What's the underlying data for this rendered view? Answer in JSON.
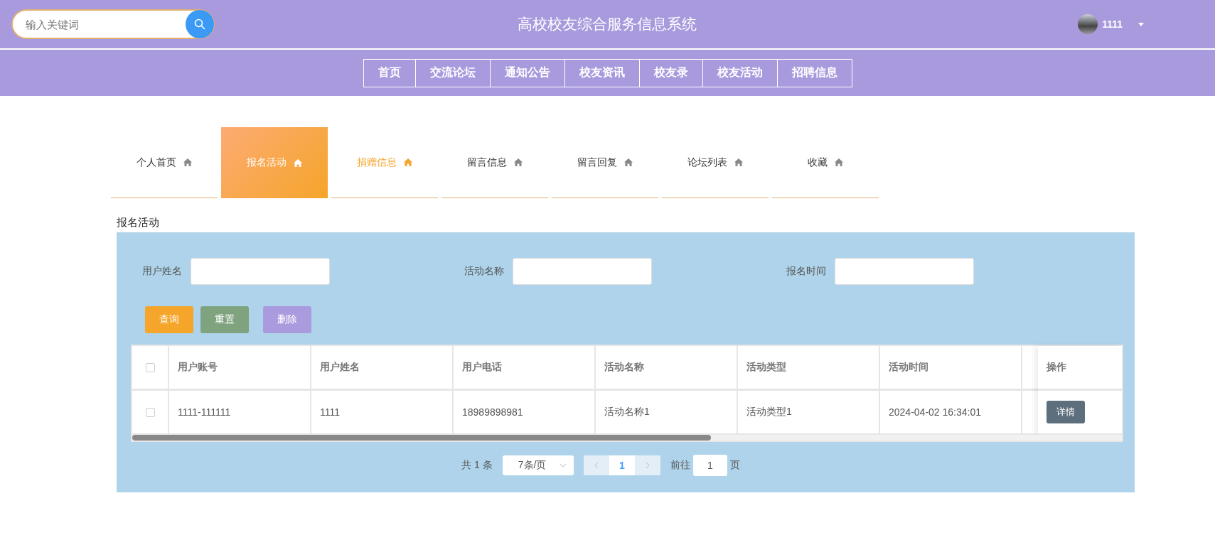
{
  "header": {
    "search": {
      "placeholder": "输入关键词"
    },
    "title": "高校校友综合服务信息系统",
    "user": {
      "name": "1111"
    }
  },
  "nav": [
    {
      "label": "首页"
    },
    {
      "label": "交流论坛"
    },
    {
      "label": "通知公告"
    },
    {
      "label": "校友资讯"
    },
    {
      "label": "校友录"
    },
    {
      "label": "校友活动"
    },
    {
      "label": "招聘信息"
    }
  ],
  "tabs": [
    {
      "label": "个人首页",
      "selected": false,
      "hovered": false
    },
    {
      "label": "报名活动",
      "selected": true,
      "hovered": false
    },
    {
      "label": "捐赠信息",
      "selected": false,
      "hovered": true
    },
    {
      "label": "留言信息",
      "selected": false,
      "hovered": false
    },
    {
      "label": "留言回复",
      "selected": false,
      "hovered": false
    },
    {
      "label": "论坛列表",
      "selected": false,
      "hovered": false
    },
    {
      "label": "收藏",
      "selected": false,
      "hovered": false
    }
  ],
  "section_title": "报名活动",
  "filters": [
    {
      "label": "用户姓名"
    },
    {
      "label": "活动名称"
    },
    {
      "label": "报名时间"
    }
  ],
  "buttons": [
    {
      "label": "查询",
      "kind": "query"
    },
    {
      "label": "重置",
      "kind": "reset"
    },
    {
      "label": "删除",
      "kind": "delete"
    }
  ],
  "table": {
    "columns": [
      "用户账号",
      "用户姓名",
      "用户电话",
      "活动名称",
      "活动类型",
      "活动时间"
    ],
    "action_column": "操作",
    "all_checked": false,
    "rows": [
      {
        "checked": false,
        "cells": [
          "1111-111111",
          "1111",
          "18989898981",
          "活动名称1",
          "活动类型1",
          "2024-04-02 16:34:01"
        ],
        "action": "详情"
      }
    ]
  },
  "pagination": {
    "total": "共 1 条",
    "page_size": "7条/页",
    "pages": [
      {
        "label": "1",
        "selected": true
      }
    ],
    "goto_label": "前往",
    "goto_value": "1",
    "goto_suffix": "页"
  }
}
